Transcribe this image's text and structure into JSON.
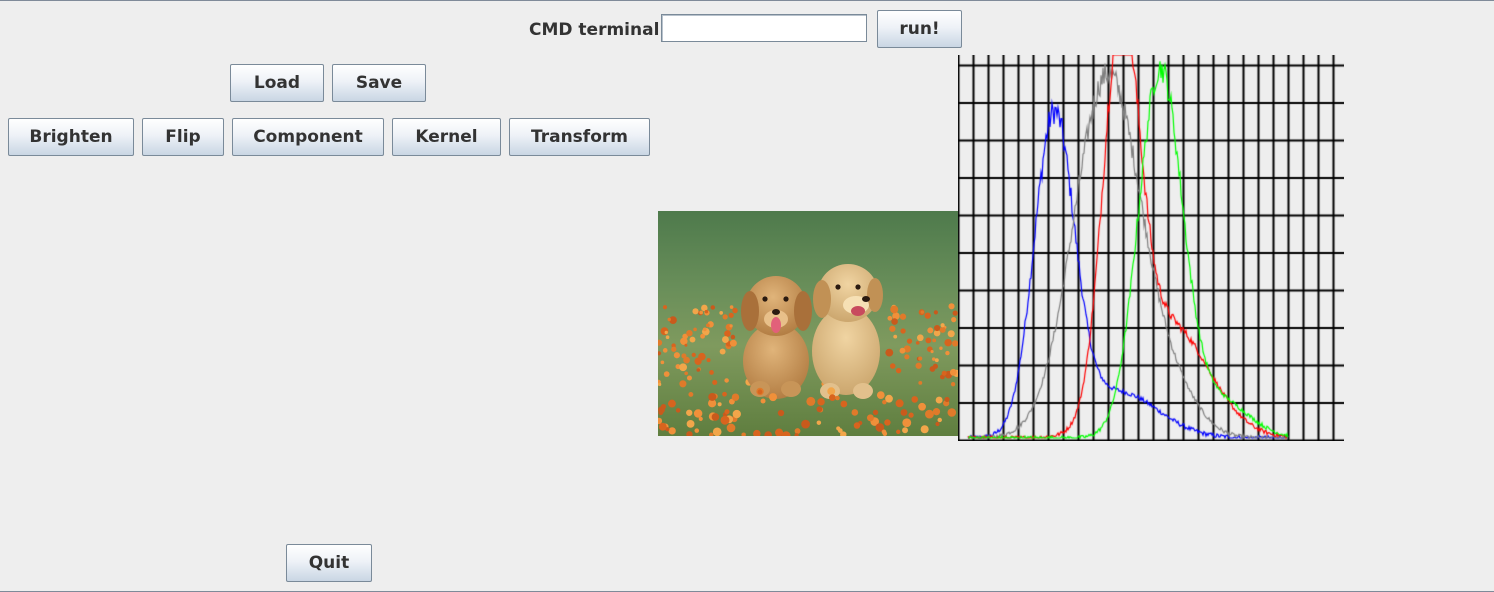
{
  "terminal": {
    "label": "CMD terminal:",
    "value": "",
    "run_label": "run!"
  },
  "file_buttons": {
    "load": "Load",
    "save": "Save"
  },
  "ops_buttons": {
    "brighten": "Brighten",
    "flip": "Flip",
    "component": "Component",
    "kernel": "Kernel",
    "transform": "Transform"
  },
  "quit_label": "Quit",
  "histogram": {
    "grid_color": "#000000",
    "series_colors": {
      "blue": "#0000ff",
      "gray": "#808080",
      "red": "#ff0000",
      "green": "#00ff00"
    }
  }
}
